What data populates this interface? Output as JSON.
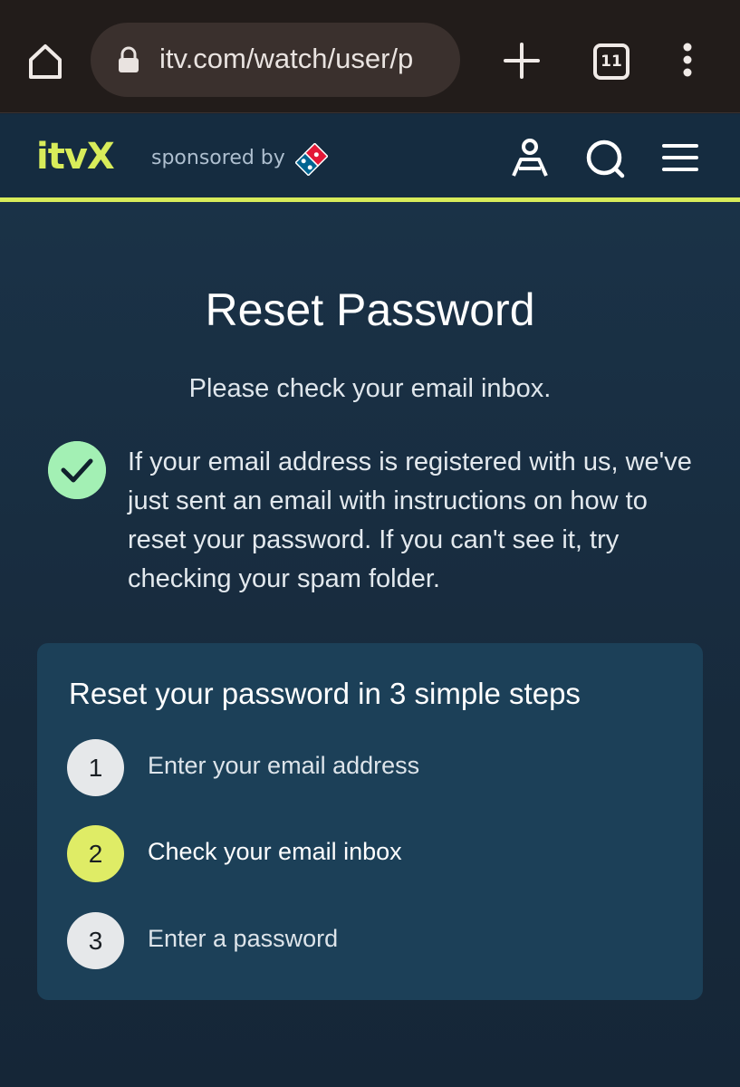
{
  "browser": {
    "url": "itv.com/watch/user/p",
    "tab_count": "11"
  },
  "header": {
    "logo": "itvX",
    "sponsor_text": "sponsored by"
  },
  "page": {
    "title": "Reset Password",
    "subtitle": "Please check your email inbox.",
    "message": "If your email address is registered with us, we've just sent an email with instructions on how to reset your password. If you can't see it, try checking your spam folder."
  },
  "steps": {
    "title": "Reset your password in 3 simple steps",
    "items": [
      {
        "number": "1",
        "label": "Enter your email address",
        "active": false
      },
      {
        "number": "2",
        "label": "Check your email inbox",
        "active": true
      },
      {
        "number": "3",
        "label": "Enter a password",
        "active": false
      }
    ]
  },
  "colors": {
    "accent": "#d8ec5a",
    "success": "#a3f0b4",
    "background": "#152637",
    "card": "#1c4058"
  },
  "icons": [
    "home-icon",
    "lock-icon",
    "plus-icon",
    "tabs-icon",
    "more-vert-icon",
    "account-icon",
    "search-icon",
    "menu-icon",
    "checkmark-icon"
  ]
}
